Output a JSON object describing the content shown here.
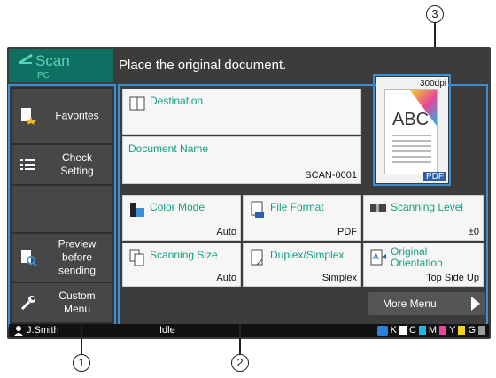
{
  "app": {
    "title": "Scan",
    "subtitle": "PC"
  },
  "message": "Place the original document.",
  "sidebar": {
    "favorites": "Favorites",
    "check_setting": "Check\nSetting",
    "preview_before_sending": "Preview\nbefore\nsending",
    "custom_menu": "Custom\nMenu"
  },
  "destination": {
    "label": "Destination"
  },
  "document_name": {
    "label": "Document Name",
    "value": "SCAN-0001"
  },
  "settings": [
    {
      "label": "Color Mode",
      "value": "Auto",
      "icon": "color-mode-icon"
    },
    {
      "label": "File Format",
      "value": "PDF",
      "icon": "file-format-icon"
    },
    {
      "label": "Scanning Level",
      "value": "±0",
      "icon": "scanning-level-icon"
    },
    {
      "label": "Scanning Size",
      "value": "Auto",
      "icon": "scanning-size-icon"
    },
    {
      "label": "Duplex/Simplex",
      "value": "Simplex",
      "icon": "duplex-simplex-icon"
    },
    {
      "label": "Original\nOrientation",
      "value": "Top Side Up",
      "icon": "original-orientation-icon"
    }
  ],
  "preview": {
    "resolution": "300dpi",
    "sample_text": "ABC",
    "format_badge": "PDF"
  },
  "more_menu": "More Menu",
  "status": {
    "user": "J.Smith",
    "state": "Idle",
    "toner": [
      {
        "letter": "K",
        "color": "#222222"
      },
      {
        "letter": "C",
        "color": "#1fb6e8"
      },
      {
        "letter": "M",
        "color": "#e8479a"
      },
      {
        "letter": "Y",
        "color": "#f2d21f"
      },
      {
        "letter": "G",
        "color": "#9a9a9a"
      }
    ]
  },
  "callouts": {
    "one": "1",
    "two": "2",
    "three": "3"
  },
  "colors": {
    "accent_green": "#159f82",
    "highlight_blue": "#3a8fd6",
    "app_tab": "#0e6f63"
  }
}
